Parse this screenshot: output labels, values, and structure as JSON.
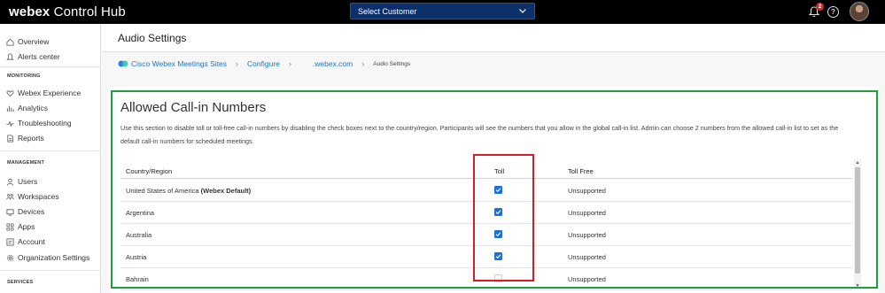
{
  "app": {
    "brand": "webex",
    "product": "Control Hub"
  },
  "topbar": {
    "customer_select": "Select Customer",
    "notification_count": "2",
    "help_glyph": "?"
  },
  "sidebar": {
    "items_top": [
      {
        "label": "Overview",
        "icon": "home-icon"
      },
      {
        "label": "Alerts center",
        "icon": "bell-icon"
      }
    ],
    "monitoring_header": "MONITORING",
    "items_monitoring": [
      {
        "label": "Webex Experience",
        "icon": "heart-icon"
      },
      {
        "label": "Analytics",
        "icon": "chart-icon"
      },
      {
        "label": "Troubleshooting",
        "icon": "pulse-icon"
      },
      {
        "label": "Reports",
        "icon": "document-icon"
      }
    ],
    "management_header": "MANAGEMENT",
    "items_management": [
      {
        "label": "Users",
        "icon": "user-icon"
      },
      {
        "label": "Workspaces",
        "icon": "workspaces-icon"
      },
      {
        "label": "Devices",
        "icon": "device-icon"
      },
      {
        "label": "Apps",
        "icon": "apps-icon"
      },
      {
        "label": "Account",
        "icon": "account-icon"
      },
      {
        "label": "Organization Settings",
        "icon": "gear-icon"
      }
    ],
    "services_header": "SERVICES"
  },
  "page": {
    "title": "Audio Settings"
  },
  "breadcrumb": {
    "items": [
      "Cisco Webex Meetings Sites",
      "Configure",
      ".webex.com"
    ],
    "current": "Audio Settings"
  },
  "card": {
    "title": "Allowed Call-in Numbers",
    "description": "Use this section to disable toll or toll-free call-in numbers by disabling the check boxes next to the country/region. Participants will see the numbers that you allow in the global call-in list. Admin can choose 2 numbers from the allowed call-in list to set as the default call-in numbers for scheduled meetings."
  },
  "table": {
    "headers": {
      "country": "Country/Region",
      "toll": "Toll",
      "toll_free": "Toll Free"
    },
    "rows": [
      {
        "country": "United States of America",
        "suffix": "(Webex Default)",
        "toll": true,
        "toll_free": "Unsupported"
      },
      {
        "country": "Argentina",
        "suffix": "",
        "toll": true,
        "toll_free": "Unsupported"
      },
      {
        "country": "Australia",
        "suffix": "",
        "toll": true,
        "toll_free": "Unsupported"
      },
      {
        "country": "Austria",
        "suffix": "",
        "toll": true,
        "toll_free": "Unsupported"
      },
      {
        "country": "Bahrain",
        "suffix": "",
        "toll": false,
        "toll_free": "Unsupported"
      }
    ]
  },
  "colors": {
    "highlight_green": "#1e9e3c",
    "highlight_red": "#d21e24",
    "checkbox": "#1f6fd4",
    "link": "#1f74c4"
  }
}
